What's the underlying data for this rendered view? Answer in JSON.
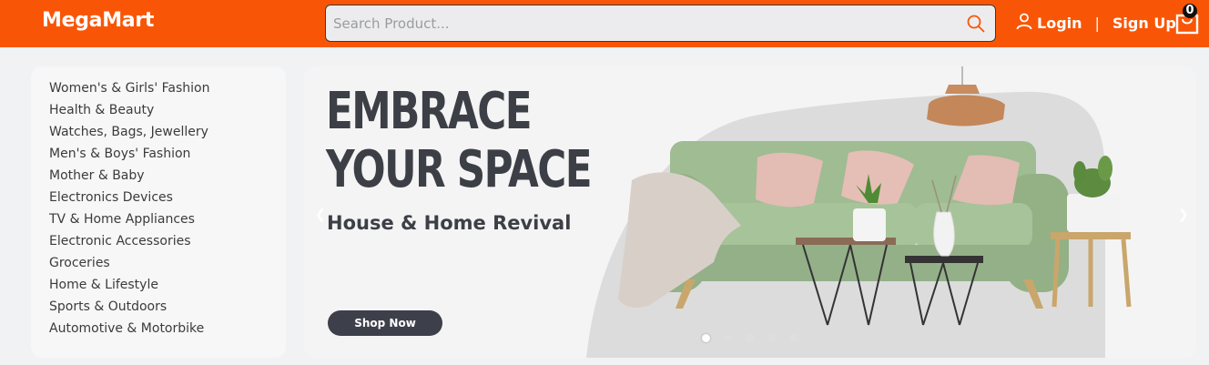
{
  "header": {
    "logo": "MegaMart",
    "search": {
      "placeholder": "Search Product..."
    },
    "login_label": "Login",
    "separator": "|",
    "signup_label": "Sign Up",
    "cart_count": "0",
    "accent_color": "#f85606"
  },
  "sidebar": {
    "categories": [
      "Women's & Girls' Fashion",
      "Health & Beauty",
      "Watches, Bags, Jewellery",
      "Men's & Boys' Fashion",
      "Mother & Baby",
      "Electronics Devices",
      "TV & Home Appliances",
      "Electronic Accessories",
      "Groceries",
      "Home & Lifestyle",
      "Sports & Outdoors",
      "Automotive & Motorbike"
    ]
  },
  "banner": {
    "headline_1": "EMBRACE",
    "headline_2": "YOUR SPACE",
    "subheading": "House & Home Revival",
    "cta_label": "Shop Now",
    "slide_count": 5,
    "active_slide": 1
  }
}
